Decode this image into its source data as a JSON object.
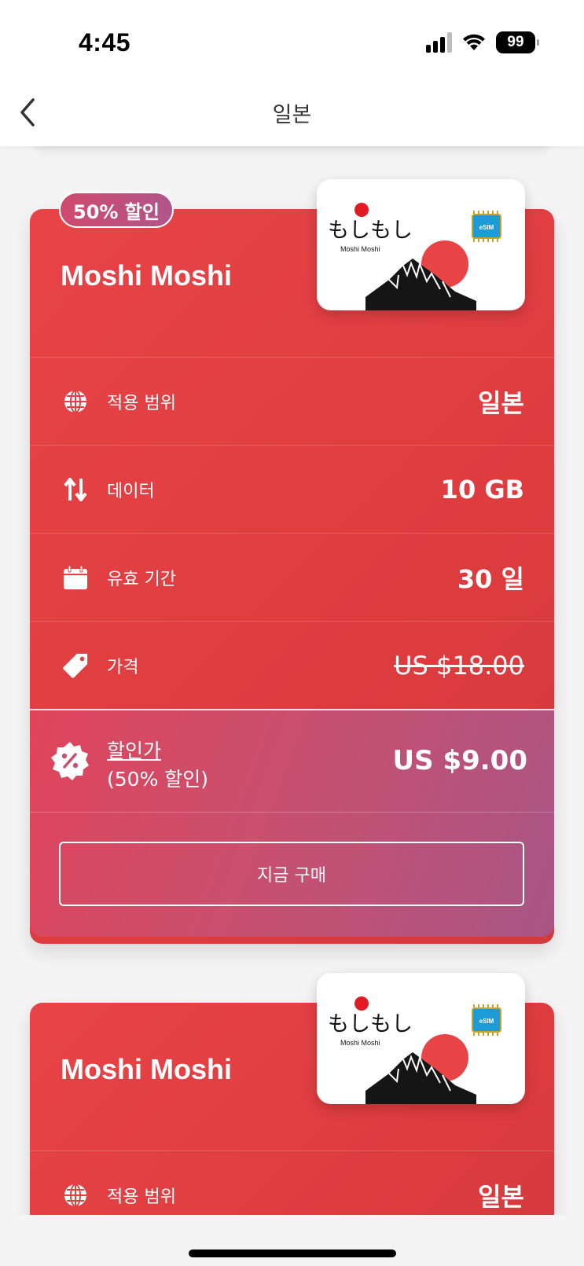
{
  "status_bar": {
    "time": "4:45",
    "battery": "99"
  },
  "nav": {
    "title": "일본"
  },
  "plans": [
    {
      "badge": "50% 할인",
      "name": "Moshi Moshi",
      "sim": {
        "brand": "もしもし",
        "brand_sub": "Moshi Moshi",
        "chip_label": "eSIM"
      },
      "rows": [
        {
          "icon": "globe-icon",
          "label": "적용 범위",
          "value": "일본"
        },
        {
          "icon": "data-transfer-icon",
          "label": "데이터",
          "value": "10 GB"
        },
        {
          "icon": "calendar-icon",
          "label": "유효 기간",
          "value": "30 일"
        },
        {
          "icon": "price-tag-icon",
          "label": "가격",
          "value": "US $18.00"
        }
      ],
      "sale": {
        "label": "할인가",
        "sub": "(50% 할인)",
        "price": "US $9.00"
      },
      "buy_label": "지금 구매"
    },
    {
      "name": "Moshi Moshi",
      "sim": {
        "brand": "もしもし",
        "brand_sub": "Moshi Moshi",
        "chip_label": "eSIM"
      },
      "rows": [
        {
          "icon": "globe-icon",
          "label": "적용 범위",
          "value": "일본"
        }
      ]
    }
  ],
  "colors": {
    "card_red": "#e84447",
    "sale_purple": "#a85585",
    "badge": "#c24f78"
  }
}
